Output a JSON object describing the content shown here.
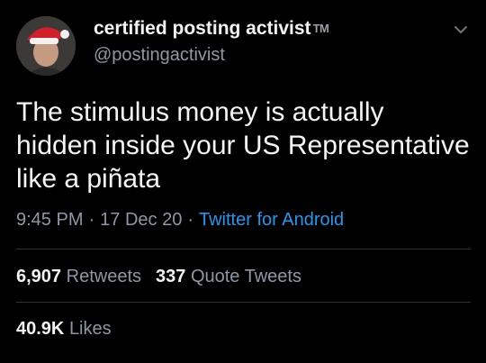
{
  "user": {
    "display_name": "certified posting activist",
    "tm": "TM",
    "handle": "@postingactivist"
  },
  "tweet": {
    "text": "The stimulus money is actually hidden inside your US Representative like a piñata",
    "time": "9:45 PM",
    "date": "17 Dec 20",
    "client": "Twitter for Android",
    "separator": "·"
  },
  "stats": {
    "retweets_count": "6,907",
    "retweets_label": "Retweets",
    "quote_count": "337",
    "quote_label": "Quote Tweets",
    "likes_count": "40.9K",
    "likes_label": "Likes"
  },
  "icons": {
    "menu": "chevron-down-icon"
  },
  "colors": {
    "background": "#000000",
    "text": "#f4f4f4",
    "secondary": "#8b98a5",
    "link": "#1d9bf0",
    "divider": "#2f3336"
  }
}
